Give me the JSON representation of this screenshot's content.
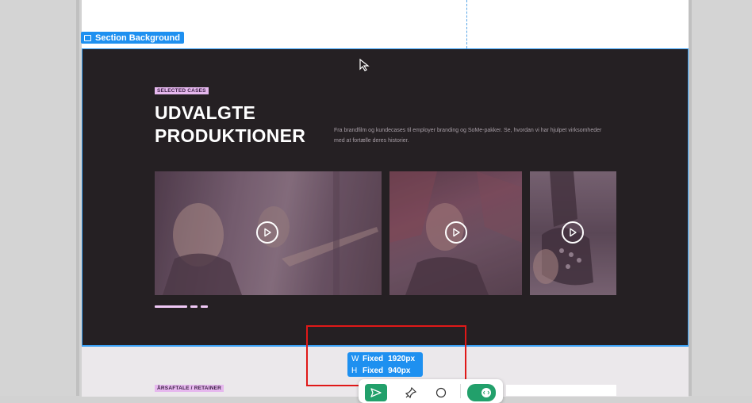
{
  "section_badge": {
    "label": "Section Background"
  },
  "cases_section": {
    "tag": "SELECTED CASES",
    "heading_line1": "UDVALGTE",
    "heading_line2": "PRODUKTIONER",
    "intro_line1": "Fra brandfilm og kundecases til employer branding og SoMe-pakker. Se, hvordan vi har hjulpet virksomheder",
    "intro_line2": "med at fortælle deres historier.",
    "cards": [
      {
        "icon": "play-icon"
      },
      {
        "icon": "play-icon"
      },
      {
        "icon": "play-icon"
      }
    ],
    "pagination_dots": 3
  },
  "next_section": {
    "tag": "ÅRSAFTALE / RETAINER"
  },
  "dimensions": {
    "w_label": "W",
    "w_mode": "Fixed",
    "w_value": "1920px",
    "h_label": "H",
    "h_mode": "Fixed",
    "h_value": "940px"
  },
  "toolbar": {
    "icons": [
      "send-icon",
      "pin-icon",
      "comment-icon",
      "code-toggle-icon"
    ]
  },
  "colors": {
    "dark_section": "#252023",
    "accent_tag": "#e6b8ee",
    "selection_blue": "#1e90f0",
    "toolbar_green": "#22a06b",
    "highlight_red": "#e01818"
  }
}
